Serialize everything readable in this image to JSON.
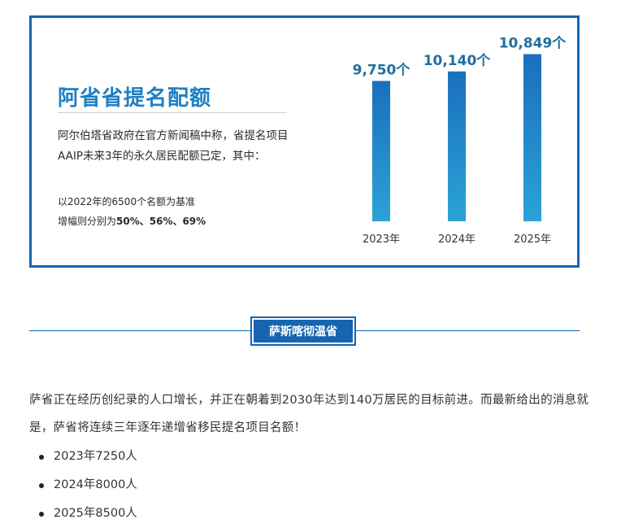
{
  "card": {
    "title": "阿省省提名配额",
    "description": "阿尔伯塔省政府在官方新闻稿中称，省提名项目AAIP未来3年的永久居民配额已定，其中：",
    "note_line1": "以2022年的6500个名额为基准",
    "note_line2_prefix": "增幅则分别为",
    "note_line2_values": "50%、56%、69%"
  },
  "chart_data": {
    "type": "bar",
    "categories": [
      "2023年",
      "2024年",
      "2025年"
    ],
    "values": [
      9750,
      10140,
      10849
    ],
    "data_labels": [
      "9,750个",
      "10,140个",
      "10,849个"
    ],
    "title": "",
    "xlabel": "",
    "ylabel": "",
    "ylim": [
      4000,
      11000
    ],
    "grid": false,
    "colors": {
      "bar_top": "#1a6fbd",
      "bar_bottom": "#2ba3d6",
      "label": "#1f6f9e",
      "axis_text": "#333333"
    }
  },
  "section": {
    "heading": "萨斯喀彻温省"
  },
  "body": {
    "paragraph": "萨省正在经历创纪录的人口增长，并正在朝着到2030年达到140万居民的目标前进。而最新给出的消息就是，萨省将连续三年逐年递增省移民提名项目名额！",
    "list": [
      "2023年7250人",
      "2024年8000人",
      "2025年8500人"
    ]
  },
  "colors": {
    "accent": "#1565b0",
    "title_blue": "#1f7fc4"
  }
}
